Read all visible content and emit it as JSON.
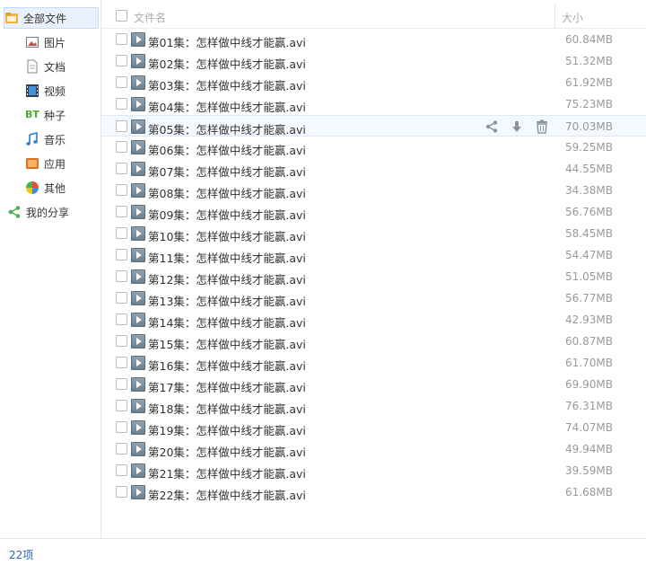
{
  "sidebar": {
    "root": {
      "label": "全部文件",
      "icon": "folder-icon"
    },
    "items": [
      {
        "label": "图片",
        "icon": "image-icon"
      },
      {
        "label": "文档",
        "icon": "document-icon"
      },
      {
        "label": "视频",
        "icon": "video-icon"
      },
      {
        "label": "种子",
        "icon": "bt-icon",
        "badge": "BT"
      },
      {
        "label": "音乐",
        "icon": "music-icon"
      },
      {
        "label": "应用",
        "icon": "app-icon"
      },
      {
        "label": "其他",
        "icon": "other-icon"
      }
    ],
    "share": {
      "label": "我的分享",
      "icon": "share-icon"
    }
  },
  "header": {
    "name_label": "文件名",
    "size_label": "大小"
  },
  "files": [
    {
      "name": "第01集：怎样做中线才能赢.avi",
      "size": "60.84MB"
    },
    {
      "name": "第02集：怎样做中线才能赢.avi",
      "size": "51.32MB"
    },
    {
      "name": "第03集：怎样做中线才能赢.avi",
      "size": "61.92MB"
    },
    {
      "name": "第04集：怎样做中线才能赢.avi",
      "size": "75.23MB"
    },
    {
      "name": "第05集：怎样做中线才能赢.avi",
      "size": "70.03MB"
    },
    {
      "name": "第06集：怎样做中线才能赢.avi",
      "size": "59.25MB"
    },
    {
      "name": "第07集：怎样做中线才能赢.avi",
      "size": "44.55MB"
    },
    {
      "name": "第08集：怎样做中线才能赢.avi",
      "size": "34.38MB"
    },
    {
      "name": "第09集：怎样做中线才能赢.avi",
      "size": "56.76MB"
    },
    {
      "name": "第10集：怎样做中线才能赢.avi",
      "size": "58.45MB"
    },
    {
      "name": "第11集：怎样做中线才能赢.avi",
      "size": "54.47MB"
    },
    {
      "name": "第12集：怎样做中线才能赢.avi",
      "size": "51.05MB"
    },
    {
      "name": "第13集：怎样做中线才能赢.avi",
      "size": "56.77MB"
    },
    {
      "name": "第14集：怎样做中线才能赢.avi",
      "size": "42.93MB"
    },
    {
      "name": "第15集：怎样做中线才能赢.avi",
      "size": "60.87MB"
    },
    {
      "name": "第16集：怎样做中线才能赢.avi",
      "size": "61.70MB"
    },
    {
      "name": "第17集：怎样做中线才能赢.avi",
      "size": "69.90MB"
    },
    {
      "name": "第18集：怎样做中线才能赢.avi",
      "size": "76.31MB"
    },
    {
      "name": "第19集：怎样做中线才能赢.avi",
      "size": "74.07MB"
    },
    {
      "name": "第20集：怎样做中线才能赢.avi",
      "size": "49.94MB"
    },
    {
      "name": "第21集：怎样做中线才能赢.avi",
      "size": "39.59MB"
    },
    {
      "name": "第22集：怎样做中线才能赢.avi",
      "size": "61.68MB"
    }
  ],
  "hover_row": 4,
  "row_actions": [
    "share-icon",
    "download-icon",
    "delete-icon"
  ],
  "footer": {
    "count": "22项"
  },
  "colors": {
    "accent": "#2b66b3",
    "hover_bg": "#f3f9fe",
    "active_bg": "#e8f1fb",
    "bt_green": "#4caf2a"
  }
}
